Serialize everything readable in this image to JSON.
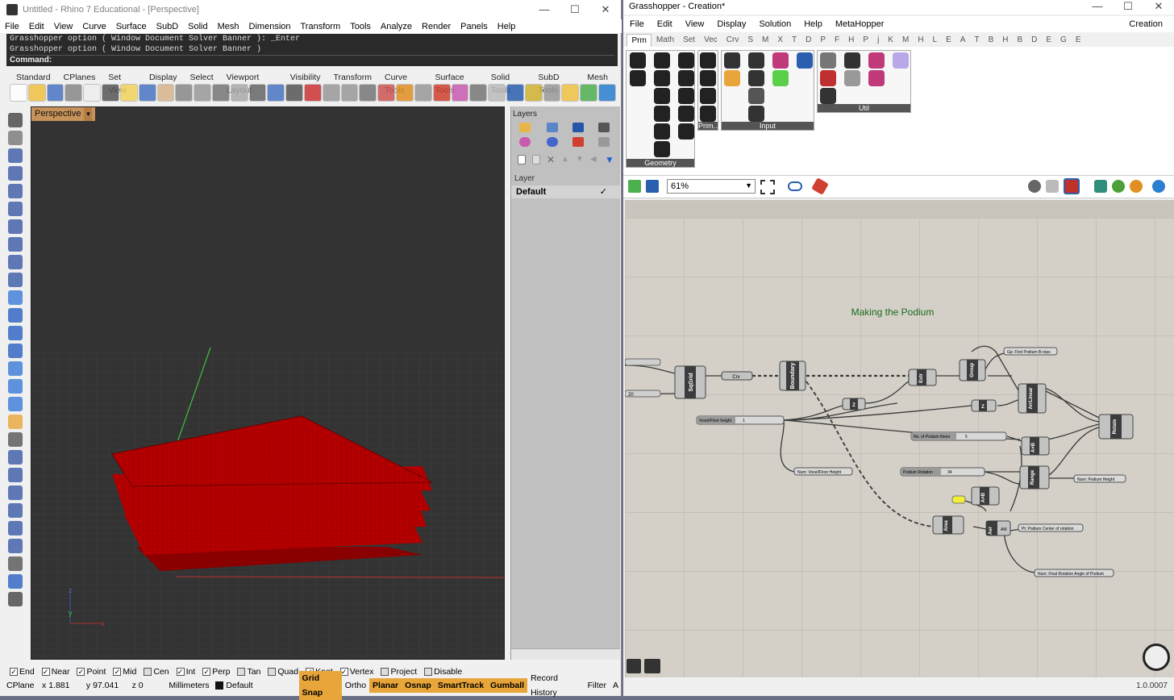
{
  "rhino": {
    "title": "Untitled - Rhino 7 Educational - [Perspective]",
    "menu": [
      "File",
      "Edit",
      "View",
      "Curve",
      "Surface",
      "SubD",
      "Solid",
      "Mesh",
      "Dimension",
      "Transform",
      "Tools",
      "Analyze",
      "Render",
      "Panels",
      "Help"
    ],
    "command_history": [
      "Grasshopper option ( Window  Document  Solver  Banner ): _Enter",
      "Grasshopper option ( Window  Document  Solver  Banner )"
    ],
    "command_prompt": "Command:",
    "toolbar_tabs": [
      "Standard",
      "CPlanes",
      "Set View",
      "Display",
      "Select",
      "Viewport Layout",
      "Visibility",
      "Transform",
      "Curve Tools",
      "Surface Tools",
      "Solid Tools",
      "SubD Tools",
      "Mesh"
    ],
    "viewport_label": "Perspective",
    "layers_title": "Layers",
    "layer_header": "Layer",
    "layer_row": {
      "name": "Default",
      "check": "✓"
    },
    "osnaps": [
      {
        "label": "End",
        "on": true
      },
      {
        "label": "Near",
        "on": true
      },
      {
        "label": "Point",
        "on": true
      },
      {
        "label": "Mid",
        "on": true
      },
      {
        "label": "Cen",
        "on": false
      },
      {
        "label": "Int",
        "on": true
      },
      {
        "label": "Perp",
        "on": true
      },
      {
        "label": "Tan",
        "on": false
      },
      {
        "label": "Quad",
        "on": false
      },
      {
        "label": "Knot",
        "on": true
      },
      {
        "label": "Vertex",
        "on": true
      },
      {
        "label": "Project",
        "on": false
      },
      {
        "label": "Disable",
        "on": false
      }
    ],
    "status": {
      "cplane": "CPlane",
      "x": "x 1.881",
      "y": "y 97.041",
      "z": "z 0",
      "units": "Millimeters",
      "layer": "Default",
      "toggles": [
        {
          "label": "Grid Snap",
          "active": true
        },
        {
          "label": "Ortho",
          "active": false
        },
        {
          "label": "Planar",
          "active": true
        },
        {
          "label": "Osnap",
          "active": true
        },
        {
          "label": "SmartTrack",
          "active": true
        },
        {
          "label": "Gumball",
          "active": true
        },
        {
          "label": "Record History",
          "active": false
        },
        {
          "label": "Filter",
          "active": false
        }
      ],
      "tail": "A"
    },
    "axis_labels": {
      "z": "z",
      "y": "y",
      "x": "x"
    }
  },
  "gh": {
    "title": "Grasshopper - Creation*",
    "menu": [
      "File",
      "Edit",
      "View",
      "Display",
      "Solution",
      "Help",
      "MetaHopper"
    ],
    "doc_name": "Creation",
    "category_tabs": [
      "Prm",
      "Math",
      "Set",
      "Vec",
      "Crv",
      "S",
      "M",
      "X",
      "T",
      "D",
      "P",
      "F",
      "H",
      "P",
      "j",
      "K",
      "M",
      "H",
      "L",
      "E",
      "A",
      "T",
      "B",
      "H",
      "B",
      "D",
      "E",
      "G",
      "E"
    ],
    "panel_labels": [
      "Geometry",
      "Prim...",
      "Input",
      "Util"
    ],
    "zoom": "61%",
    "canvas_group_title": "Making the Podium",
    "version": "1.0.0007",
    "nodes": {
      "sqgrid": "SqGrid",
      "boundary": "Boundary",
      "extr": "Extr",
      "group": "Group",
      "arrlinear": "ArrLinear",
      "rotate": "Rotate",
      "z1": "Z",
      "z2": "Z",
      "axb1": "A×B",
      "axb2": "A×B",
      "range": "Range",
      "area": "Area",
      "avr": "Avr",
      "crv": "Crv"
    },
    "params": {
      "voxel_floor_height": "Voxel/Floor height",
      "voxel_value": "1",
      "podium_floors": "No. of Podium floors",
      "podium_floors_value": "5",
      "podium_rotation": "Podium Rotation",
      "podium_rotation_value": "34",
      "grid_input_value": "20",
      "out_gp": "Gp: First Podium B-reps",
      "out_num_voxel": "Num: Voxel/Floor Height",
      "out_num_podium": "Num: Podium Height",
      "out_pt": "Pt: Podium Center of rotation",
      "out_rot": "Num: Final Rotation Angle of Podium",
      "am": "AM"
    }
  }
}
